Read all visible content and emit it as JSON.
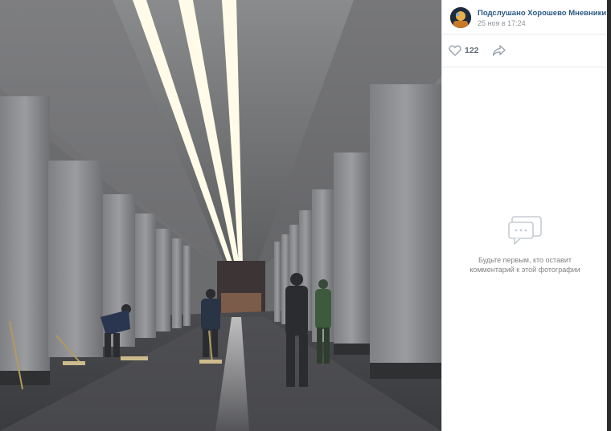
{
  "post": {
    "author_name": "Подслушано Хорошево Мневники",
    "date": "25 ноя в 17:24",
    "likes": "122"
  },
  "comments": {
    "empty_text": "Будьте первым, кто оставит комментарий к этой фотографии"
  },
  "icons": {
    "like": "heart-outline-icon",
    "share": "share-arrow-icon",
    "comments_empty": "speech-bubble-icon"
  },
  "colors": {
    "link": "#2a5885",
    "muted": "#939699",
    "sidebar_bg": "#ffffff",
    "viewer_bg": "#3a3b3c"
  }
}
